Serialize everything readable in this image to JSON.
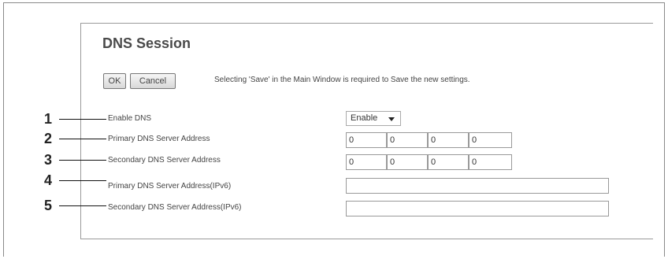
{
  "dialog": {
    "title": "DNS Session",
    "ok_label": "OK",
    "cancel_label": "Cancel",
    "notice": "Selecting 'Save' in the Main Window is required to Save the new settings."
  },
  "fields": [
    {
      "callout": "1",
      "label": "Enable DNS",
      "value": "Enable"
    },
    {
      "callout": "2",
      "label": "Primary DNS Server Address",
      "octets": [
        "0",
        "0",
        "0",
        "0"
      ]
    },
    {
      "callout": "3",
      "label": "Secondary DNS Server Address",
      "octets": [
        "0",
        "0",
        "0",
        "0"
      ]
    },
    {
      "callout": "4",
      "label": "Primary DNS Server Address(IPv6)",
      "value": ""
    },
    {
      "callout": "5",
      "label": "Secondary DNS Server Address(IPv6)",
      "value": ""
    }
  ]
}
